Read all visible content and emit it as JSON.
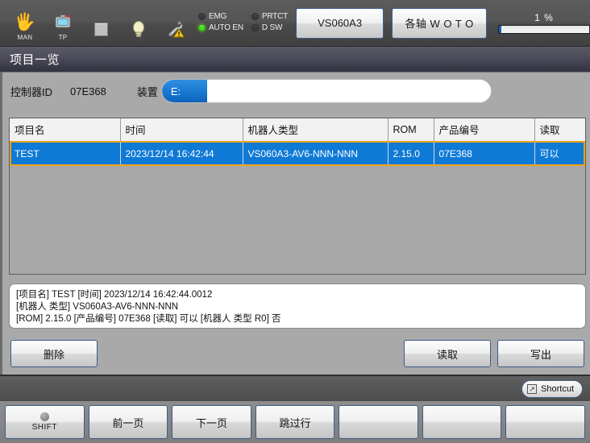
{
  "topbar": {
    "mode_icon": "hand-icon",
    "mode_label": "MAN",
    "tp_icon": "teach-pendant-icon",
    "tp_label": "TP",
    "stop_icon": "stop-square-icon",
    "lamp_icon": "lamp-icon",
    "maint_icon": "wrench-warning-icon",
    "leds": [
      {
        "label": "EMG",
        "on": false
      },
      {
        "label": "PRTCT",
        "on": false
      },
      {
        "label": "AUTO EN",
        "on": true
      },
      {
        "label": "D SW",
        "on": false
      }
    ],
    "model_button": "VS060A3",
    "axis_button": "各轴 W O T O",
    "speed_value": "1 %",
    "speed_percent": 1
  },
  "page": {
    "title": "项目一览"
  },
  "info": {
    "controller_id_label": "控制器ID",
    "controller_id_value": "07E368",
    "device_label": "装置",
    "device_tag": "E:",
    "device_value": "",
    "device_placeholder": ""
  },
  "table": {
    "columns": [
      "项目名",
      "时间",
      "机器人类型",
      "ROM",
      "产品编号",
      "读取"
    ],
    "rows": [
      {
        "selected": true,
        "cells": [
          "TEST",
          "2023/12/14 16:42:44",
          "VS060A3-AV6-NNN-NNN",
          "2.15.0",
          "07E368",
          "可以"
        ]
      }
    ]
  },
  "detail": {
    "line1": "[项目名] TEST  [时间] 2023/12/14 16:42:44.0012",
    "line2": "[机器人 类型] VS060A3-AV6-NNN-NNN",
    "line3": "[ROM] 2.15.0  [产品编号] 07E368  [读取] 可以  [机器人 类型 R0] 否"
  },
  "actions": {
    "delete_label": "删除",
    "read_label": "读取",
    "write_label": "写出"
  },
  "shortcut": {
    "icon": "shortcut-arrow-icon",
    "label": "Shortcut"
  },
  "fkeys": [
    {
      "name": "shift",
      "label": "SHIFT",
      "has_dot": true
    },
    {
      "name": "prev-page",
      "label": "前一页",
      "has_dot": false
    },
    {
      "name": "next-page",
      "label": "下一页",
      "has_dot": false
    },
    {
      "name": "skip-line",
      "label": "跳过行",
      "has_dot": false
    },
    {
      "name": "f5",
      "label": "",
      "has_dot": false
    },
    {
      "name": "f6",
      "label": "",
      "has_dot": false
    },
    {
      "name": "f7",
      "label": "",
      "has_dot": false
    }
  ],
  "colors": {
    "selection_blue": "#0f7ad6",
    "selection_outline": "#f2a01a",
    "led_on_green": "#45e01a",
    "button_border": "#3c5d8a"
  }
}
